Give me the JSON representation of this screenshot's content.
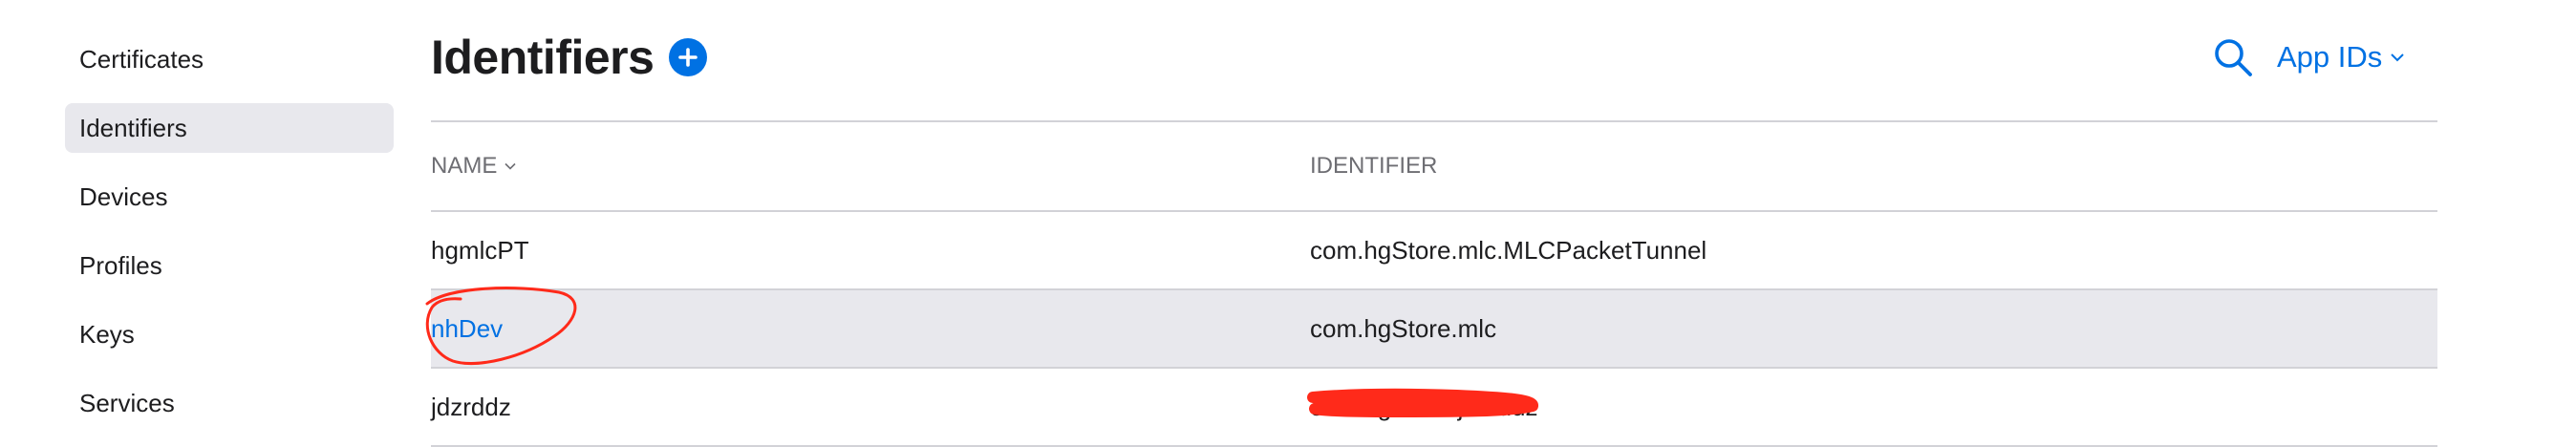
{
  "sidebar": {
    "items": [
      {
        "label": "Certificates"
      },
      {
        "label": "Identifiers"
      },
      {
        "label": "Devices"
      },
      {
        "label": "Profiles"
      },
      {
        "label": "Keys"
      },
      {
        "label": "Services"
      }
    ]
  },
  "header": {
    "title": "Identifiers",
    "filter_label": "App IDs"
  },
  "table": {
    "columns": [
      "NAME",
      "IDENTIFIER"
    ],
    "rows": [
      {
        "name": "hgmlcPT",
        "identifier": "com.hgStore.mlc.MLCPacketTunnel"
      },
      {
        "name": "nhDev",
        "identifier": "com.hgStore.mlc"
      },
      {
        "name": "jdzrddz",
        "identifier": "com.hgStore.jdzrddz"
      }
    ]
  },
  "colors": {
    "accent": "#0071e3",
    "selected_row": "#e8e8ed",
    "annotation_red": "#ff2a1a"
  },
  "icons": [
    "add-icon",
    "search-icon",
    "chevron-down-icon",
    "sort-chevron-icon"
  ]
}
